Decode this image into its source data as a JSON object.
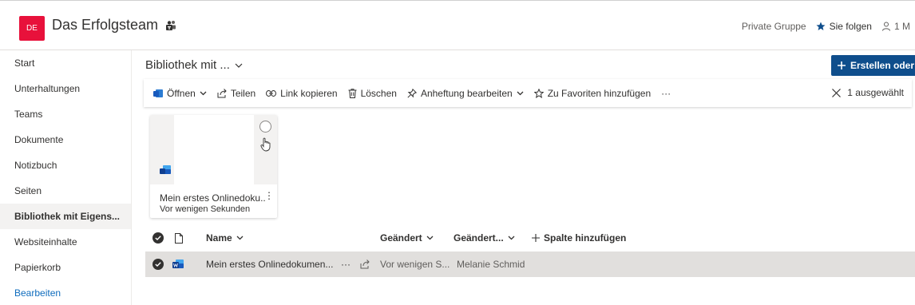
{
  "header": {
    "avatar_text": "DE",
    "site_title": "Das Erfolgsteam",
    "privacy": "Private Gruppe",
    "follow_label": "Sie folgen",
    "members_label": "1 M"
  },
  "sidebar": {
    "items": [
      {
        "label": "Start"
      },
      {
        "label": "Unterhaltungen"
      },
      {
        "label": "Teams"
      },
      {
        "label": "Dokumente"
      },
      {
        "label": "Notizbuch"
      },
      {
        "label": "Seiten"
      },
      {
        "label": "Bibliothek mit Eigens..."
      },
      {
        "label": "Websiteinhalte"
      },
      {
        "label": "Papierkorb"
      },
      {
        "label": "Bearbeiten"
      }
    ],
    "active_index": 6
  },
  "library": {
    "title": "Bibliothek mit ...",
    "create_label": "Erstellen oder"
  },
  "commandbar": {
    "open": "Öffnen",
    "share": "Teilen",
    "copy_link": "Link kopieren",
    "delete": "Löschen",
    "pin": "Anheftung bearbeiten",
    "favorite": "Zu Favoriten hinzufügen",
    "more": "···",
    "selected": "1 ausgewählt"
  },
  "tile": {
    "name": "Mein erstes Onlinedoku...",
    "more": "⋮",
    "meta": "Vor wenigen Sekunden"
  },
  "list": {
    "headers": {
      "name": "Name",
      "modified": "Geändert",
      "modified_by": "Geändert...",
      "add_column": "Spalte hinzufügen"
    },
    "rows": [
      {
        "name": "Mein erstes Onlinedokumen...",
        "more": "···",
        "modified": "Vor wenigen S...",
        "modified_by": "Melanie Schmid"
      }
    ]
  },
  "colors": {
    "avatar": "#e8113b",
    "accent": "#0f6cbd",
    "create_button": "#0f4e8c",
    "selected_row": "#e1dfdd",
    "active_nav": "#f3f2f1"
  }
}
